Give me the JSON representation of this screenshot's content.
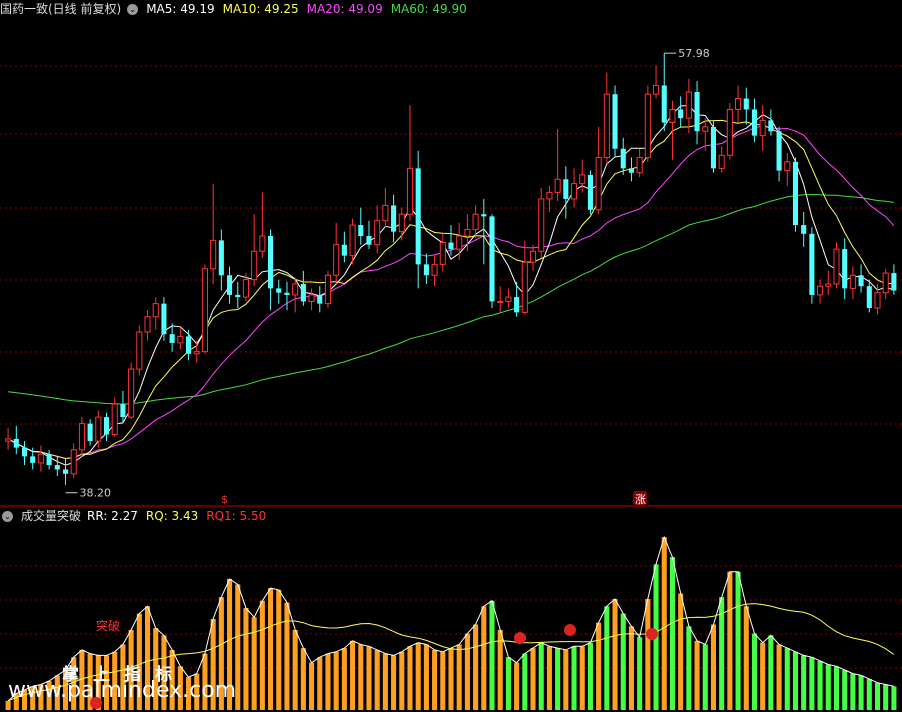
{
  "header": {
    "title": "国药一致(日线 前复权)",
    "ma": [
      {
        "label": "MA5: 49.19",
        "color": "#ffffff"
      },
      {
        "label": "MA10: 49.25",
        "color": "#ffff55"
      },
      {
        "label": "MA20: 49.09",
        "color": "#ff44ff"
      },
      {
        "label": "MA60: 49.90",
        "color": "#44dd44"
      }
    ]
  },
  "sub_header": {
    "title": "成交量突破",
    "values": [
      {
        "label": "RR: 2.27",
        "color": "#ffffff"
      },
      {
        "label": "RQ: 3.43",
        "color": "#ffff55"
      },
      {
        "label": "RQ1: 5.50",
        "color": "#ff3333"
      }
    ]
  },
  "annotations": {
    "high": "57.98",
    "low": "38.20",
    "signal_up": "涨",
    "breakout": "突破"
  },
  "watermark": {
    "cn": "掌上指标",
    "url": "www.palmindex.com"
  },
  "colors": {
    "up": "#ff3333",
    "down": "#55ffff",
    "vol_up": "#ffa020",
    "vol_green": "#44ff44",
    "grid": "#8b0000"
  },
  "chart_data": [
    {
      "type": "candlestick",
      "ylim": [
        37.5,
        59.5
      ],
      "high_label": 57.98,
      "low_label": 38.2,
      "candles": [
        [
          40.2,
          40.8,
          39.8,
          40.3
        ],
        [
          40.3,
          40.9,
          39.6,
          39.9
        ],
        [
          39.9,
          40.2,
          39.1,
          39.5
        ],
        [
          39.5,
          39.9,
          38.9,
          39.2
        ],
        [
          39.2,
          40.0,
          38.8,
          39.6
        ],
        [
          39.6,
          39.8,
          38.9,
          39.1
        ],
        [
          39.1,
          39.5,
          38.6,
          38.9
        ],
        [
          38.9,
          39.4,
          38.2,
          38.7
        ],
        [
          38.7,
          40.1,
          38.5,
          39.8
        ],
        [
          39.8,
          41.3,
          39.5,
          41.0
        ],
        [
          41.0,
          41.2,
          40.0,
          40.2
        ],
        [
          40.2,
          41.6,
          39.9,
          41.3
        ],
        [
          41.3,
          41.5,
          40.2,
          40.5
        ],
        [
          40.5,
          42.2,
          40.4,
          41.9
        ],
        [
          41.9,
          42.5,
          41.0,
          41.3
        ],
        [
          41.3,
          43.8,
          41.2,
          43.5
        ],
        [
          43.5,
          45.5,
          43.2,
          45.2
        ],
        [
          45.2,
          46.2,
          44.8,
          45.9
        ],
        [
          45.9,
          46.8,
          45.3,
          46.5
        ],
        [
          46.5,
          46.8,
          44.8,
          45.1
        ],
        [
          45.1,
          45.6,
          44.3,
          44.7
        ],
        [
          44.7,
          45.4,
          44.4,
          45.0
        ],
        [
          45.0,
          45.3,
          43.9,
          44.2
        ],
        [
          44.2,
          44.8,
          43.8,
          44.3
        ],
        [
          44.3,
          48.3,
          44.2,
          48.1
        ],
        [
          48.1,
          52.0,
          47.4,
          49.4
        ],
        [
          49.4,
          49.9,
          47.1,
          47.8
        ],
        [
          47.8,
          48.2,
          46.5,
          46.9
        ],
        [
          46.9,
          47.5,
          46.3,
          46.8
        ],
        [
          46.8,
          47.9,
          46.6,
          47.6
        ],
        [
          47.6,
          50.6,
          47.3,
          48.9
        ],
        [
          48.9,
          51.6,
          48.6,
          49.6
        ],
        [
          49.6,
          49.9,
          46.2,
          47.2
        ],
        [
          47.2,
          47.6,
          46.5,
          47.0
        ],
        [
          47.0,
          47.5,
          46.2,
          46.9
        ],
        [
          46.9,
          47.7,
          46.1,
          47.4
        ],
        [
          47.4,
          48.0,
          46.4,
          46.6
        ],
        [
          46.6,
          47.2,
          46.2,
          46.9
        ],
        [
          46.9,
          47.3,
          46.1,
          46.5
        ],
        [
          46.5,
          48.0,
          46.3,
          47.8
        ],
        [
          47.8,
          50.2,
          47.4,
          49.2
        ],
        [
          49.2,
          49.8,
          48.4,
          48.7
        ],
        [
          48.7,
          50.4,
          48.3,
          50.1
        ],
        [
          50.1,
          50.9,
          49.2,
          49.6
        ],
        [
          49.6,
          50.3,
          49.0,
          49.2
        ],
        [
          49.2,
          51.0,
          48.8,
          50.3
        ],
        [
          50.3,
          51.8,
          50.0,
          51.0
        ],
        [
          51.0,
          51.5,
          49.3,
          49.8
        ],
        [
          49.8,
          50.9,
          49.4,
          50.6
        ],
        [
          50.6,
          55.6,
          50.3,
          52.7
        ],
        [
          52.7,
          53.5,
          47.2,
          48.3
        ],
        [
          48.3,
          48.8,
          47.4,
          47.8
        ],
        [
          47.8,
          48.7,
          47.3,
          48.3
        ],
        [
          48.3,
          49.7,
          48.0,
          49.3
        ],
        [
          49.3,
          50.1,
          48.7,
          49.0
        ],
        [
          49.0,
          50.2,
          48.5,
          49.6
        ],
        [
          49.6,
          50.6,
          48.9,
          49.9
        ],
        [
          49.9,
          51.0,
          49.5,
          50.6
        ],
        [
          50.6,
          51.3,
          48.3,
          50.5
        ],
        [
          50.5,
          50.6,
          46.3,
          46.6
        ],
        [
          46.6,
          47.3,
          46.1,
          46.6
        ],
        [
          46.6,
          47.2,
          46.3,
          46.8
        ],
        [
          46.8,
          47.5,
          45.9,
          46.1
        ],
        [
          46.1,
          49.4,
          46.0,
          48.4
        ],
        [
          48.4,
          49.2,
          48.0,
          48.9
        ],
        [
          48.9,
          51.8,
          48.6,
          51.3
        ],
        [
          51.3,
          51.9,
          50.7,
          51.6
        ],
        [
          51.6,
          54.5,
          51.2,
          52.2
        ],
        [
          52.2,
          52.8,
          50.4,
          51.3
        ],
        [
          51.3,
          52.7,
          50.9,
          52.0
        ],
        [
          52.0,
          53.1,
          51.6,
          52.4
        ],
        [
          52.4,
          52.6,
          50.6,
          50.8
        ],
        [
          50.8,
          54.6,
          50.6,
          53.2
        ],
        [
          53.2,
          57.1,
          52.9,
          56.1
        ],
        [
          56.1,
          56.5,
          53.2,
          53.6
        ],
        [
          53.6,
          54.1,
          52.4,
          52.7
        ],
        [
          52.7,
          53.2,
          52.1,
          52.5
        ],
        [
          52.5,
          53.6,
          52.3,
          53.2
        ],
        [
          53.2,
          56.5,
          53.0,
          56.1
        ],
        [
          56.1,
          57.4,
          55.9,
          56.5
        ],
        [
          56.5,
          57.98,
          54.4,
          54.8
        ],
        [
          54.8,
          55.8,
          53.1,
          55.4
        ],
        [
          55.4,
          56.0,
          54.6,
          55.0
        ],
        [
          55.0,
          56.8,
          54.3,
          56.2
        ],
        [
          56.2,
          56.7,
          53.8,
          54.4
        ],
        [
          54.4,
          55.0,
          53.5,
          54.6
        ],
        [
          54.6,
          54.9,
          52.5,
          52.7
        ],
        [
          52.7,
          53.7,
          52.5,
          53.3
        ],
        [
          53.3,
          55.7,
          53.1,
          55.4
        ],
        [
          55.4,
          56.5,
          54.8,
          55.9
        ],
        [
          55.9,
          56.4,
          54.7,
          55.4
        ],
        [
          55.4,
          55.9,
          53.9,
          54.2
        ],
        [
          54.2,
          55.6,
          53.5,
          54.9
        ],
        [
          54.9,
          55.4,
          54.2,
          54.4
        ],
        [
          54.4,
          54.6,
          52.1,
          52.6
        ],
        [
          52.6,
          53.4,
          51.9,
          53.0
        ],
        [
          53.0,
          53.2,
          49.8,
          50.1
        ],
        [
          50.1,
          50.7,
          49.1,
          49.7
        ],
        [
          49.7,
          50.0,
          46.5,
          46.9
        ],
        [
          46.9,
          47.6,
          46.5,
          47.3
        ],
        [
          47.3,
          48.0,
          46.9,
          47.4
        ],
        [
          47.4,
          49.3,
          47.2,
          49.0
        ],
        [
          49.0,
          49.5,
          46.7,
          47.2
        ],
        [
          47.2,
          48.2,
          46.7,
          47.8
        ],
        [
          47.8,
          48.3,
          47.0,
          47.3
        ],
        [
          47.3,
          47.6,
          46.1,
          46.3
        ],
        [
          46.3,
          47.4,
          46.0,
          47.0
        ],
        [
          47.0,
          48.1,
          46.7,
          47.9
        ],
        [
          47.9,
          48.3,
          46.9,
          47.1
        ]
      ]
    },
    {
      "type": "bar",
      "ylim": [
        0,
        100
      ],
      "values": [
        5,
        9,
        11,
        13,
        14,
        16,
        19,
        22,
        29,
        33,
        31,
        30,
        30,
        32,
        36,
        44,
        53,
        57,
        45,
        41,
        33,
        24,
        18,
        20,
        31,
        50,
        62,
        72,
        69,
        56,
        51,
        60,
        67,
        66,
        59,
        44,
        34,
        26,
        29,
        31,
        32,
        34,
        38,
        36,
        35,
        33,
        31,
        30,
        32,
        35,
        37,
        36,
        33,
        32,
        34,
        36,
        42,
        47,
        57,
        60,
        44,
        29,
        26,
        31,
        34,
        37,
        35,
        34,
        33,
        35,
        35,
        37,
        48,
        57,
        61,
        53,
        46,
        40,
        61,
        80,
        95,
        84,
        64,
        46,
        38,
        36,
        47,
        62,
        76,
        76,
        57,
        42,
        37,
        41,
        36,
        34,
        32,
        30,
        29,
        27,
        25,
        24,
        22,
        20,
        19,
        17,
        15,
        14,
        13
      ],
      "green_from_index": 58
    }
  ]
}
